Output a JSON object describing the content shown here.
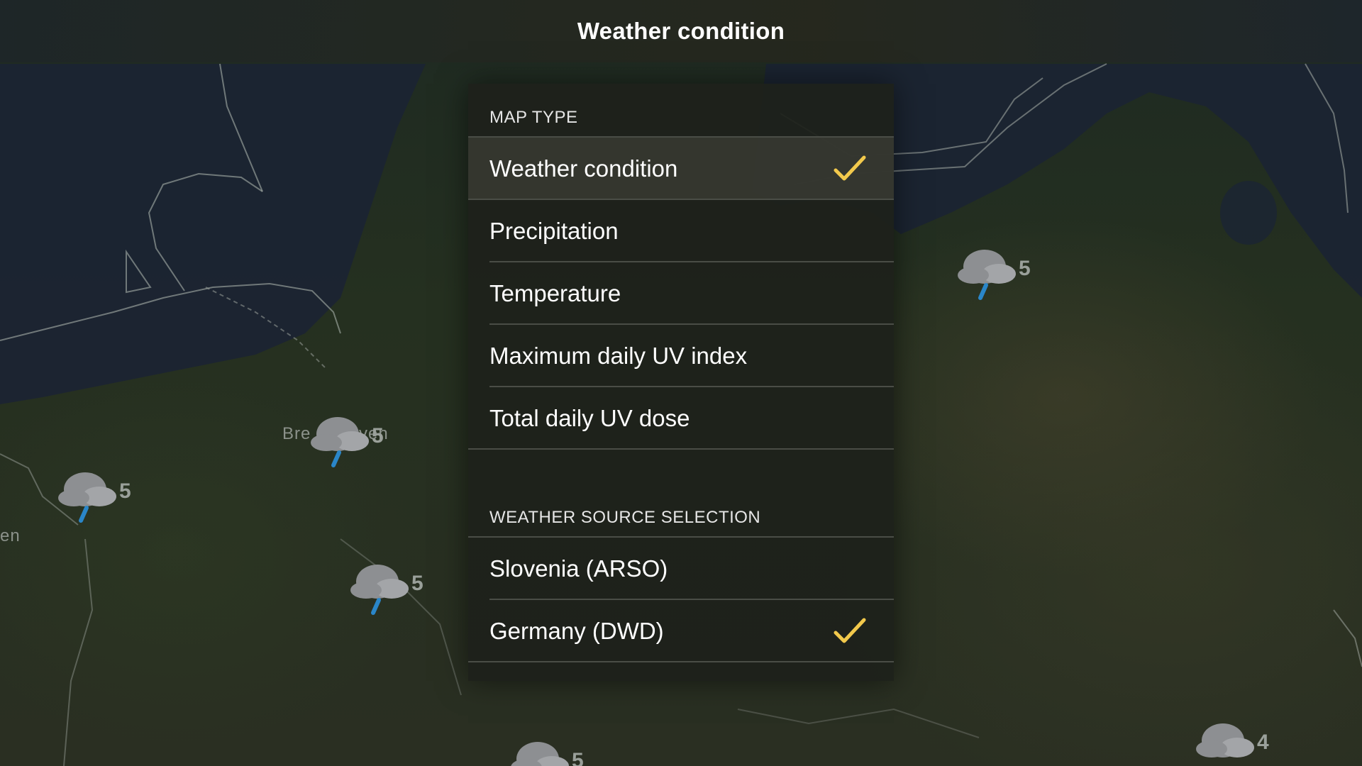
{
  "header": {
    "title": "Weather condition"
  },
  "dialog": {
    "map_type": {
      "header": "MAP TYPE",
      "items": [
        {
          "label": "Weather condition",
          "selected": true
        },
        {
          "label": "Precipitation",
          "selected": false
        },
        {
          "label": "Temperature",
          "selected": false
        },
        {
          "label": "Maximum daily UV index",
          "selected": false
        },
        {
          "label": "Total daily UV dose",
          "selected": false
        }
      ]
    },
    "weather_source": {
      "header": "WEATHER SOURCE SELECTION",
      "items": [
        {
          "label": "Slovenia (ARSO)",
          "selected": false
        },
        {
          "label": "Germany (DWD)",
          "selected": true
        }
      ]
    }
  },
  "map": {
    "labels": [
      "Bre",
      "ven",
      "en"
    ],
    "markers": [
      {
        "value": "5",
        "icon": "rain-cloud-icon"
      },
      {
        "value": "5",
        "icon": "rain-cloud-icon"
      },
      {
        "value": "5",
        "icon": "rain-cloud-icon"
      },
      {
        "value": "5",
        "icon": "rain-cloud-icon"
      },
      {
        "value": "5",
        "icon": "cloud-icon"
      },
      {
        "value": "4",
        "icon": "cloud-icon"
      }
    ]
  },
  "colors": {
    "accent_check": "#f2c94c",
    "rain_drop": "#2a86c9"
  }
}
